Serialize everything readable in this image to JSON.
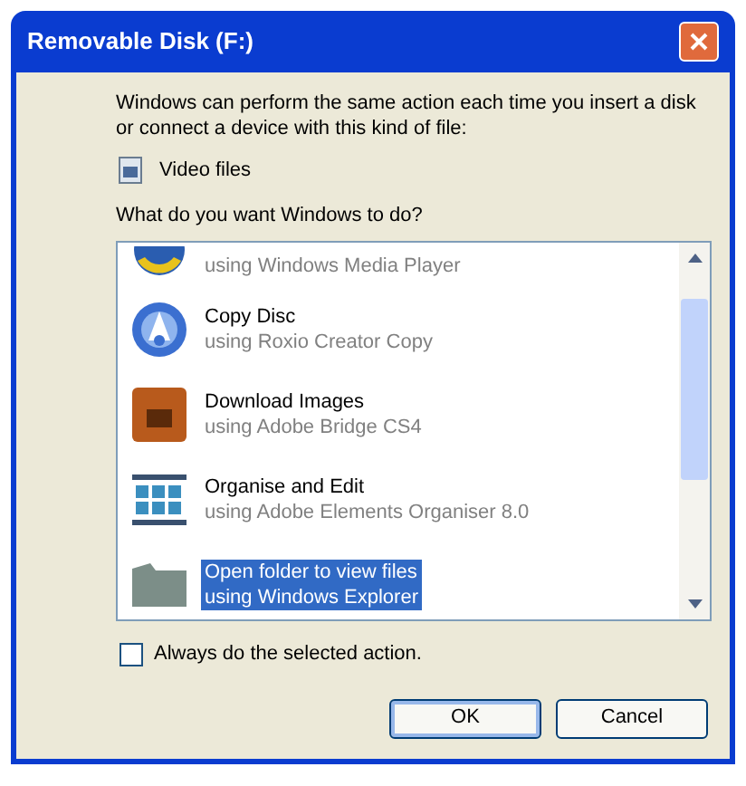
{
  "window": {
    "title": "Removable Disk (F:)"
  },
  "intro": "Windows can perform the same action each time you insert a disk or connect a device with this kind of file:",
  "content_type": "Video files",
  "question": "What do you want Windows to do?",
  "actions": [
    {
      "kind": "media",
      "subtitle": "using Windows Media Player",
      "selected": false
    },
    {
      "kind": "disc",
      "title": "Copy Disc",
      "subtitle": "using Roxio Creator Copy",
      "selected": false
    },
    {
      "kind": "bridge",
      "title": "Download Images",
      "subtitle": "using Adobe Bridge CS4",
      "selected": false
    },
    {
      "kind": "organizer",
      "title": "Organise and Edit",
      "subtitle": "using Adobe Elements Organiser 8.0",
      "selected": false
    },
    {
      "kind": "folder",
      "title": "Open folder to view files",
      "subtitle": "using Windows Explorer",
      "selected": true
    }
  ],
  "always": {
    "label": "Always do the selected action.",
    "checked": false
  },
  "buttons": [
    "OK",
    "Cancel"
  ]
}
